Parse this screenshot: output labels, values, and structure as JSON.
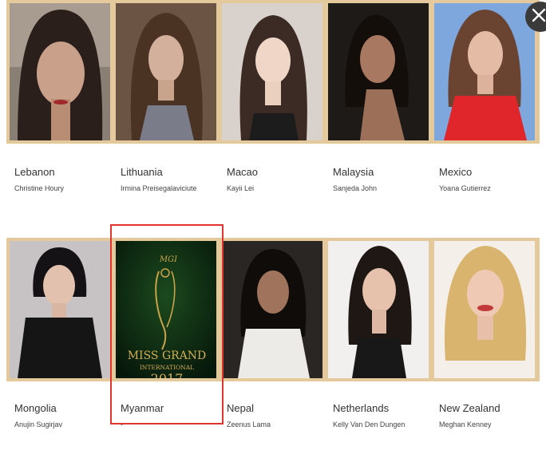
{
  "contestants": [
    {
      "country": "Lebanon",
      "name": "Christine Houry"
    },
    {
      "country": "Lithuania",
      "name": "Irmina Preisegalaviciute"
    },
    {
      "country": "Macao",
      "name": "Kayii Lei"
    },
    {
      "country": "Malaysia",
      "name": "Sanjeda John"
    },
    {
      "country": "Mexico",
      "name": "Yoana Gutierrez"
    },
    {
      "country": "Mongolia",
      "name": "Anujin Sugirjav"
    },
    {
      "country": "Myanmar",
      "name": "-"
    },
    {
      "country": "Nepal",
      "name": "Zeenus Lama"
    },
    {
      "country": "Netherlands",
      "name": "Kelly Van Den Dungen"
    },
    {
      "country": "New Zealand",
      "name": "Meghan Kenney"
    }
  ],
  "placeholder_logo": {
    "badge": "MGI",
    "line1": "MISS GRAND",
    "line2": "INTERNATIONAL",
    "year": "2017"
  },
  "colors": {
    "frame": "#e3c99b",
    "highlight": "#e0342f",
    "logo_bg": "#0c2a0e",
    "logo_gold": "#c9a24a"
  }
}
